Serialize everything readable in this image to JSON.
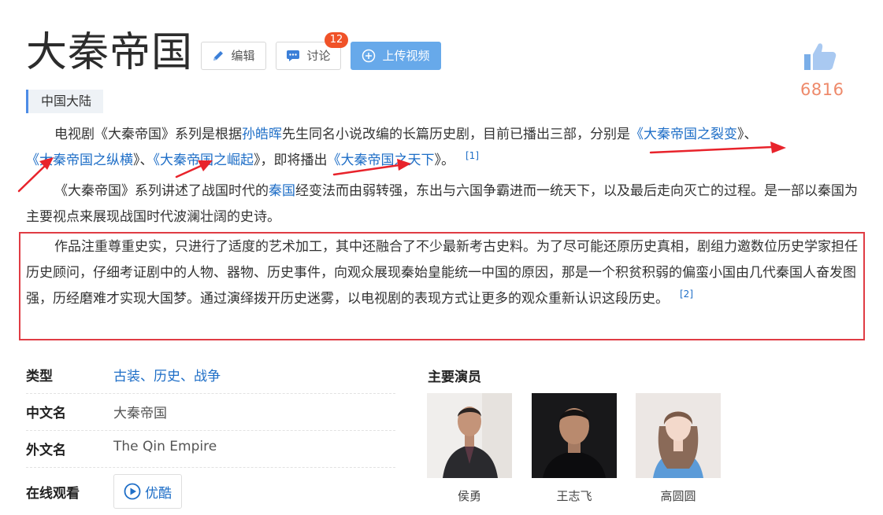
{
  "header": {
    "title": "大秦帝国",
    "edit_label": "编辑",
    "discuss_label": "讨论",
    "discuss_count": "12",
    "upload_label": "上传视频",
    "like_count": "6816",
    "region_tag": "中国大陆"
  },
  "para1": {
    "t1": "电视剧《大秦帝国》系列是根据",
    "author": "孙皓晖",
    "t2": "先生同名小说改编的长篇历史剧，目前已播出三部，分别是",
    "lq1": "《",
    "w1": "大秦帝国之裂变",
    "rq1": "》、",
    "lq2": "《",
    "w2": "大秦帝国之纵横",
    "rq2": "》、",
    "lq3": "《",
    "w3": "大秦帝国之崛起",
    "rq3": "》，即将播出",
    "lq4": "《",
    "w4": "大秦帝国之天下",
    "rq4": "》。",
    "ref": "[1]"
  },
  "para2": {
    "t1": "《大秦帝国》系列讲述了战国时代的",
    "state": "秦国",
    "t2": "经变法而由弱转强，东出与六国争霸进而一统天下，以及最后走向灭亡的过程。是一部以秦国为主要视点来展现战国时代波澜壮阔的史诗。"
  },
  "para3": {
    "text": "作品注重尊重史实，只进行了适度的艺术加工，其中还融合了不少最新考古史料。为了尽可能还原历史真相，剧组力邀数位历史学家担任历史顾问，仔细考证剧中的人物、器物、历史事件，向观众展现秦始皇能统一中国的原因，那是一个积贫积弱的偏蛮小国由几代秦国人奋发图强，历经磨难才实现大国梦。通过演绎拨开历史迷雾，以电视剧的表现方式让更多的观众重新认识这段历史。",
    "ref": "[2]"
  },
  "info": {
    "genre_label": "类型",
    "genres": [
      "古装",
      "历史",
      "战争"
    ],
    "genre_sep": "、",
    "cn_name_label": "中文名",
    "cn_name": "大秦帝国",
    "en_name_label": "外文名",
    "en_name": "The Qin Empire",
    "watch_label": "在线观看",
    "watch_platform": "优酷"
  },
  "cast": {
    "heading": "主要演员",
    "members": [
      {
        "name": "侯勇"
      },
      {
        "name": "王志飞"
      },
      {
        "name": "高圆圆"
      }
    ]
  },
  "colors": {
    "link": "#1e6ec7",
    "badge": "#f05228",
    "upload_button": "#67a9ea",
    "highlight_border": "#e03c44",
    "like_count": "#ee8a6b",
    "annotation_arrow": "#e8232b"
  },
  "icons": [
    "pencil-icon",
    "chat-bubble-icon",
    "plus-circle-icon",
    "thumbs-up-icon",
    "play-circle-icon"
  ]
}
